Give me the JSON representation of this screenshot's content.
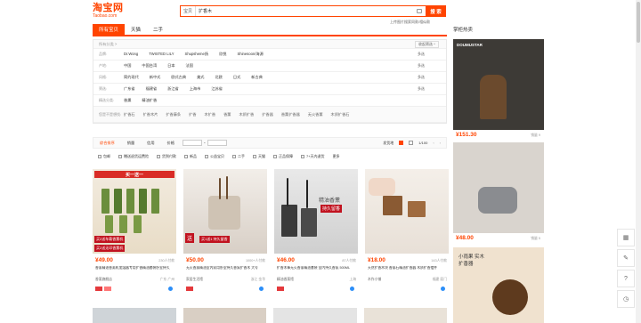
{
  "header": {
    "logo_main": "淘宝网",
    "logo_sub": "Taobao.com",
    "search_scope": "宝贝",
    "search_value": "扩香木",
    "search_button": "搜 索",
    "sub_link": "上传图片搜索同款/相似款"
  },
  "tabs": [
    {
      "label": "所有宝贝"
    },
    {
      "label": "天猫"
    },
    {
      "label": "二手"
    }
  ],
  "filters": {
    "top_label": "所有分类 >",
    "top_right": "收起筛选 ^",
    "rows": [
      {
        "label": "品牌:",
        "values": [
          "Dr.Wong",
          "TWISTED LILY",
          "Shupsheme扬",
          "欣悦",
          "Shinesoon/海源"
        ],
        "more": "多选"
      },
      {
        "label": "产地:",
        "values": [
          "中国",
          "中国台湾",
          "日本",
          "法国"
        ],
        "more": "多选"
      },
      {
        "label": "风格:",
        "values": [
          "简约现代",
          "新中式",
          "欧式古典",
          "美式",
          "北欧",
          "日式",
          "新古典"
        ],
        "more": "多选"
      },
      {
        "label": "筛选:",
        "values": [
          "广东省",
          "福建省",
          "浙江省",
          "上海市",
          "江苏省"
        ],
        "more": "多选"
      },
      {
        "label": "精选分类:",
        "values": [
          "香熏",
          "精油扩香"
        ],
        "more": ""
      }
    ],
    "related_label": "您是不是想找:",
    "related": [
      "扩香石",
      "扩香木片",
      "扩香藤条",
      "扩香",
      "木扩香",
      "香薰",
      "木质扩香",
      "扩香器",
      "香薰扩香器",
      "无火香薰",
      "木质扩香石",
      "木扩香",
      "藤条扩香",
      "香氛"
    ]
  },
  "sortbar": {
    "items": [
      "综合排序",
      "销量",
      "信用",
      "价格"
    ],
    "price_sep": "-",
    "ship": "发货地",
    "page": "1/100"
  },
  "options": [
    "包邮",
    "赠送退货运费险",
    "货到付款",
    "新品",
    "公益宝贝",
    "二手",
    "天猫",
    "正品保障",
    "7+天内退货",
    "更多"
  ],
  "products": [
    {
      "banner": "买一送一",
      "promo": "买2送车载香薰机",
      "promo2": "买2送无印香薰机",
      "price": "¥49.00",
      "sold": "230人付款",
      "title": "香薰精油香薰机加湿器专用扩香精油套装卧室持久",
      "shop": "香薰旗舰店",
      "loc": "广东 广州"
    },
    {
      "banner": "",
      "promo": "送",
      "promo2": "买1送1 持久留香",
      "price": "¥50.00",
      "sold": "1000+人付款",
      "title": "无火香薰精油室内家用卧室持久香氛扩香木 大号",
      "shop": "家居生活馆",
      "loc": "浙江 金华"
    },
    {
      "banner": "",
      "promo": "精油香薰",
      "promo2": "持久留香",
      "price": "¥46.00",
      "sold": "87人付款",
      "title": "扩香木棒无火香薰精油套装 室内持久香氛 500ML",
      "shop": "精油香薰馆",
      "loc": "上海"
    },
    {
      "banner": "",
      "promo": "",
      "promo2": "",
      "price": "¥18.00",
      "sold": "143人付款",
      "title": "天然扩香木块 香薰石精油扩香器 木质扩香摆件",
      "shop": "木作小铺",
      "loc": "福建 厦门"
    }
  ],
  "side": {
    "title": "掌柜热卖",
    "cards": [
      {
        "brand": "DOUMUSTAR",
        "price": "¥151.30",
        "sold": "销量 9"
      },
      {
        "brand": "",
        "price": "¥48.00",
        "sold": "销量 5"
      },
      {
        "brand": "小雨果 实木扩香器",
        "price": "",
        "sold": ""
      }
    ]
  },
  "tools": [
    "qrcode",
    "edit",
    "help",
    "history"
  ]
}
